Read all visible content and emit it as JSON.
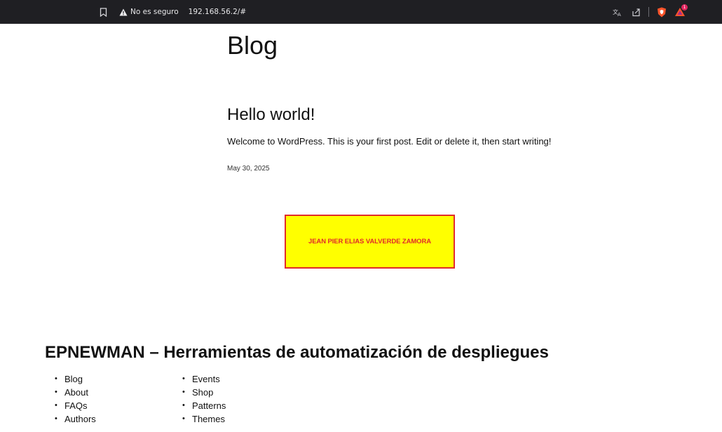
{
  "browser": {
    "security_label": "No es seguro",
    "url": "192.168.56.2/#",
    "icons": [
      "bookmark-icon",
      "warning-icon",
      "translate-icon",
      "share-icon",
      "brave-shield-icon",
      "brave-rewards-icon"
    ],
    "rewards_badge": "1",
    "colors": {
      "bar_bg": "#1f1f23",
      "brave_orange": "#fb542b"
    }
  },
  "page": {
    "blog_title": "Blog",
    "post": {
      "title": "Hello world!",
      "excerpt": "Welcome to WordPress. This is your first post. Edit or delete it, then start writing!",
      "date": "May 30, 2025"
    },
    "name_box": {
      "text": "JEAN PIER ELIAS VALVERDE ZAMORA",
      "colors": {
        "background": "#ffff00",
        "border": "#e12b2b",
        "text": "#e12b2b"
      }
    },
    "footer": {
      "site_title": "EPNEWMAN – Herramientas de automatización de despliegues",
      "nav_col1": [
        "Blog",
        "About",
        "FAQs",
        "Authors"
      ],
      "nav_col2": [
        "Events",
        "Shop",
        "Patterns",
        "Themes"
      ]
    }
  }
}
